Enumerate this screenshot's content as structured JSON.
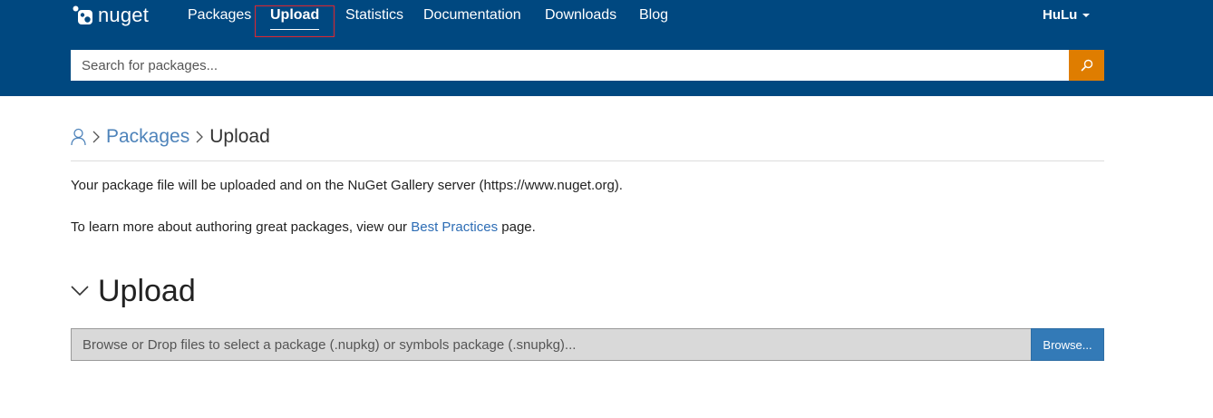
{
  "header": {
    "logo_text": "nuget",
    "nav": [
      {
        "label": "Packages"
      },
      {
        "label": "Upload"
      },
      {
        "label": "Statistics"
      },
      {
        "label": "Documentation"
      },
      {
        "label": "Downloads"
      },
      {
        "label": "Blog"
      }
    ],
    "active_nav": "Upload",
    "user": "HuLu",
    "background_color": "#004880"
  },
  "search": {
    "placeholder": "Search for packages...",
    "value": "",
    "button_icon": "search-icon",
    "button_color": "#df7d00"
  },
  "breadcrumb": {
    "icon": "user-icon",
    "items": [
      "Packages",
      "Upload"
    ]
  },
  "intro": {
    "line1": "Your package file will be uploaded and on the NuGet Gallery server (https://www.nuget.org).",
    "line2_prefix": "To learn more about authoring great packages, view our ",
    "line2_link": "Best Practices",
    "line2_suffix": " page."
  },
  "upload_section": {
    "title": "Upload",
    "expanded": true,
    "drop_text": "Browse or Drop files to select a package (.nupkg) or symbols package (.snupkg)...",
    "browse_label": "Browse..."
  }
}
